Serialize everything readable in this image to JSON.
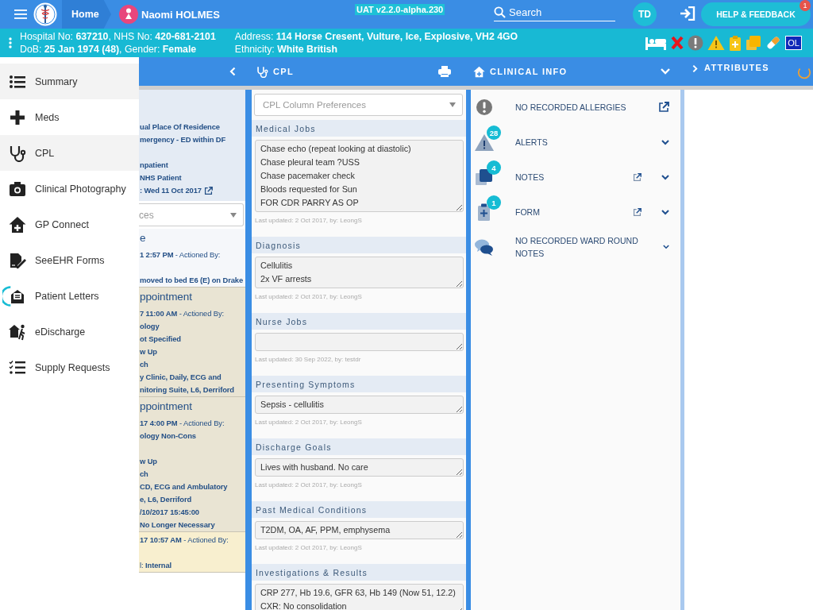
{
  "top_bar": {
    "home_label": "Home",
    "patient_name": "Naomi HOLMES",
    "environment": "UAT v2.2.0-alpha.230",
    "search_placeholder": "Search",
    "user_initials": "TD",
    "help_button": "HELP & FEEDBACK",
    "help_badge": "1"
  },
  "patient_bar": {
    "details": [
      "Hospital No: **637210**, NHS No: **420-681-2101**",
      "DoB: **25 Jan 1974 (48)**, Gender: **Female**"
    ],
    "address": [
      "Address: **114 Horse Cresent, Vulture, Ice, Explosive, VH2 4GO**",
      "Ethnicity: **White British**"
    ],
    "badge": "OL"
  },
  "menu": {
    "items": [
      {
        "kind": "summary",
        "label": "Summary",
        "highlighted": true,
        "loading": false
      },
      {
        "kind": "meds",
        "label": "Meds",
        "highlighted": false,
        "loading": false
      },
      {
        "kind": "cpl",
        "label": "CPL",
        "highlighted": true,
        "loading": false
      },
      {
        "kind": "photo",
        "label": "Clinical Photography",
        "highlighted": false,
        "loading": false
      },
      {
        "kind": "gp",
        "label": "GP Connect",
        "highlighted": false,
        "loading": false
      },
      {
        "kind": "forms",
        "label": "SeeEHR Forms",
        "highlighted": false,
        "loading": false
      },
      {
        "kind": "letters",
        "label": "Patient Letters",
        "highlighted": false,
        "loading": true
      },
      {
        "kind": "discharge",
        "label": "eDischarge",
        "highlighted": false,
        "loading": false
      },
      {
        "kind": "supply",
        "label": "Supply Requests",
        "highlighted": false,
        "loading": false
      }
    ]
  },
  "timeline": {
    "summary": {
      "color": "#e4ebf4",
      "groups": [
        [
          {
            "kind": "value",
            "text": "ual Place Of Residence"
          },
          {
            "kind": "value",
            "text": "mergency - ED within DF"
          }
        ],
        [
          {
            "kind": "value",
            "text": "npatient"
          },
          {
            "kind": "value",
            "text": "NHS Patient"
          },
          {
            "kind": "value",
            "text": ": Wed 11 Oct 2017",
            "edit_link": true
          }
        ]
      ]
    },
    "filter": {
      "placeholder": "ces"
    },
    "entries": [
      {
        "color": "#f5f7fa",
        "groups": [
          [
            {
              "kind": "title",
              "text": "e"
            },
            {
              "kind": "mixed",
              "text": "**1 2:57 PM** - Actioned By:"
            }
          ],
          [
            {
              "kind": "value",
              "text": "moved to bed E6 (E) on Drake"
            }
          ]
        ]
      },
      {
        "color": "#e9e4d3",
        "groups": [
          [
            {
              "kind": "title",
              "text": "ppointment"
            },
            {
              "kind": "mixed",
              "text": "**7 11:00 AM** - Actioned By:"
            },
            {
              "kind": "value",
              "text": "ology"
            },
            {
              "kind": "value",
              "text": "ot Specified"
            },
            {
              "kind": "value",
              "text": "w Up"
            },
            {
              "kind": "value",
              "text": "ch"
            },
            {
              "kind": "value",
              "text": "y Clinic, Daily, ECG and"
            },
            {
              "kind": "value",
              "text": "nitoring Suite, L6, Derriford"
            }
          ]
        ]
      },
      {
        "color": "#e9e4d3",
        "groups": [
          [
            {
              "kind": "title",
              "text": "ppointment"
            },
            {
              "kind": "mixed",
              "text": "**17 4:00 PM** - Actioned By:"
            },
            {
              "kind": "value",
              "text": "ology Non-Cons"
            }
          ],
          [
            {
              "kind": "value",
              "text": "w Up"
            },
            {
              "kind": "value",
              "text": "ch"
            },
            {
              "kind": "value",
              "text": "CD, ECG and Ambulatory"
            },
            {
              "kind": "value",
              "text": "e, L6, Derriford"
            },
            {
              "kind": "value",
              "text": "/10/2017 15:45:00"
            },
            {
              "kind": "value",
              "text": "No Longer Necessary"
            }
          ]
        ]
      },
      {
        "color": "#f8efcf",
        "groups": [
          [
            {
              "kind": "mixed",
              "text": "**17 10:57 AM** - Actioned By:"
            }
          ],
          [
            {
              "kind": "mixed",
              "text": "l: **Internal**"
            }
          ]
        ]
      }
    ]
  },
  "cpl": {
    "title": "CPL",
    "preferences_placeholder": "CPL Column Preferences",
    "sections": [
      {
        "title": "Medical Jobs",
        "value": "Chase echo (repeat looking at diastolic)\nChase pleural team ?USS\nChase pacemaker check\nBloods requested for Sun\nFOR CDR PARRY AS OP",
        "updated": "Last updated: 2 Oct 2017, by: LeongS"
      },
      {
        "title": "Diagnosis",
        "value": "Cellulitis\n2x VF arrests",
        "updated": "Last updated: 2 Oct 2017, by: LeongS"
      },
      {
        "title": "Nurse Jobs",
        "updated": "Last updated: 30 Sep 2022, by: testdr"
      },
      {
        "title": "Presenting Symptoms",
        "value": "Sepsis - cellulitis",
        "updated": "Last updated: 2 Oct 2017, by: LeongS"
      },
      {
        "title": "Discharge Goals",
        "value": "Lives with husband. No care",
        "updated": "Last updated: 2 Oct 2017, by: LeongS"
      },
      {
        "title": "Past Medical Conditions",
        "value": "T2DM, OA, AF, PPM, emphysema",
        "updated": "Last updated: 2 Oct 2017, by: LeongS"
      },
      {
        "title": "Investigations & Results",
        "value": "CRP 277, Hb 19.6, GFR 63, Hb 149 (Now 51, 12.2)\nCXR: No consolidation"
      }
    ]
  },
  "clinical_info": {
    "title": "CLINICAL INFO",
    "items": [
      {
        "kind": "allergies",
        "label": "NO RECORDED ALLERGIES",
        "open_link": true,
        "expandable": false
      },
      {
        "kind": "alerts",
        "label": "ALERTS",
        "badge": "28",
        "open_link": false,
        "expandable": true
      },
      {
        "kind": "notes",
        "label": "NOTES",
        "badge": "4",
        "open_link": true,
        "expandable": true
      },
      {
        "kind": "form",
        "label": "FORM",
        "badge": "1",
        "open_link": true,
        "expandable": true
      },
      {
        "kind": "ward",
        "label": "NO RECORDED WARD ROUND NOTES",
        "open_link": false,
        "expandable": true
      }
    ]
  },
  "attributes": {
    "title": "ATTRIBUTES",
    "loading": true
  }
}
